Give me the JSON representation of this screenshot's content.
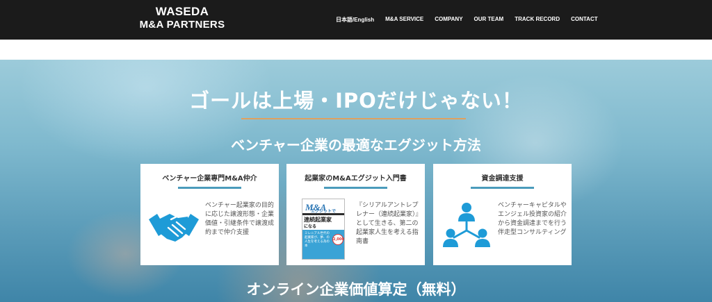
{
  "header": {
    "logo_line1": "WASEDA",
    "logo_line2": "M&A PARTNERS",
    "nav": [
      "日本語/English",
      "M&A SERVICE",
      "COMPANY",
      "OUR TEAM",
      "TRACK RECORD",
      "CONTACT"
    ]
  },
  "hero": {
    "headline": "ゴールは上場・IPOだけじゃない！",
    "subheadline": "ベンチャー企業の最適なエグジット方法",
    "bottom_title": "オンライン企業価値算定（無料）"
  },
  "cards": [
    {
      "title": "ベンチャー企業専門M&A仲介",
      "icon": "handshake-icon",
      "text": "ベンチャー起業家の目的に応じた譲渡形態・企業価値・引継条件で譲渡成約まで仲介支援"
    },
    {
      "title": "起業家のM&Aエグジット入門書",
      "icon": "book-cover",
      "text": "『シリアルアントレプレナー（連続起業家）』として生きる、第二の起業家人生を考える指南書"
    },
    {
      "title": "資金調達支援",
      "icon": "network-people-icon",
      "text": "ベンチャーキャピタルやエンジェル投資家の紹介から資金調達までを行う伴走型コンサルティング"
    }
  ],
  "book": {
    "ma": "M&A",
    "sub": "エグジットで",
    "main": "連続起業家",
    "main2": "になる",
    "blurb": "ミレニアル世代の起業家が、夢、の人生を考える為の本",
    "badge": "2,000"
  },
  "colors": {
    "header_bg": "#1b1b1b",
    "accent_divider": "#e0a15e",
    "card_bar": "#4a9bbb",
    "icon_blue": "#1e9bd7"
  }
}
